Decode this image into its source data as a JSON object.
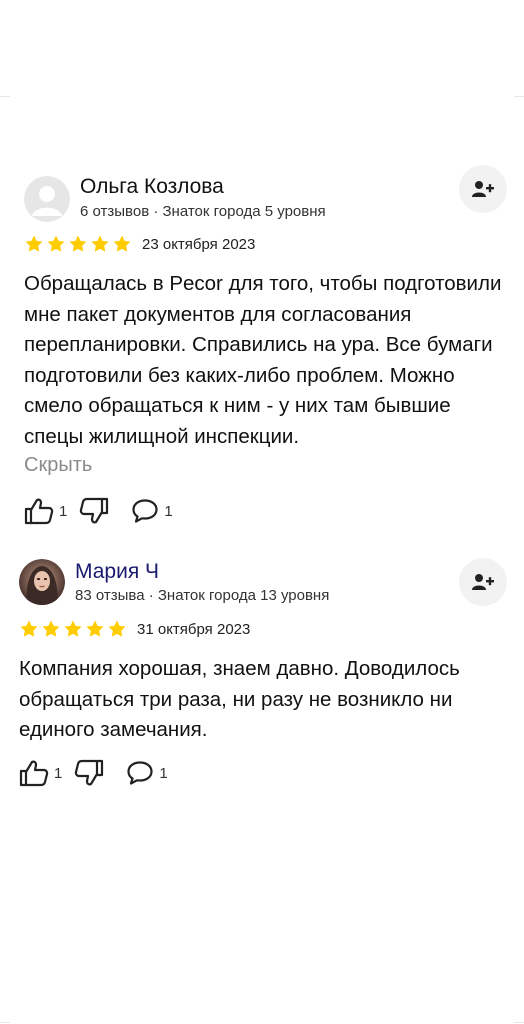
{
  "reviews": [
    {
      "author": "Ольга Козлова",
      "meta": "6 отзывов · Знаток города 5 уровня",
      "rating": 5,
      "date": "23 октября 2023",
      "text": "Обращалась в Pecor для того, чтобы подготовили мне пакет документов для согласования перепланировки. Справились на ура. Все бумаги подготовили без каких-либо проблем. Можно смело обращаться к ним - у них там бывшие спецы жилищной инспекции.",
      "collapse_label": "Скрыть",
      "likes": "1",
      "comments": "1",
      "avatar": "default-avatar-icon"
    },
    {
      "author": "Мария Ч",
      "meta": "83 отзыва · Знаток города 13 уровня",
      "rating": 5,
      "date": "31 октября 2023",
      "text": "Компания хорошая, знаем давно. Доводилось обращаться три раза, ни разу не возникло ни единого замечания.",
      "likes": "1",
      "comments": "1",
      "avatar": "user-photo"
    }
  ],
  "colors": {
    "star": "#FFCC00",
    "muted": "#8a8a8a",
    "button_bg": "#f2f2f2"
  }
}
